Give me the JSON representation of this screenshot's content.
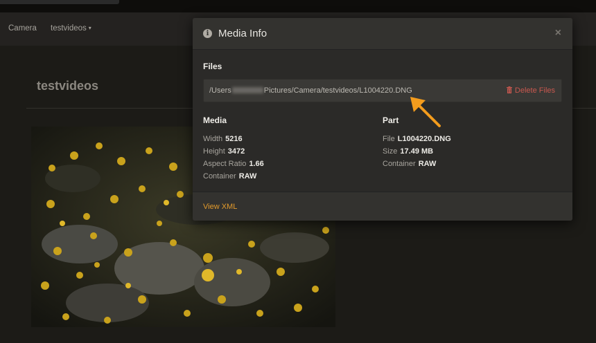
{
  "nav": {
    "camera_label": "Camera",
    "library_label": "testvideos",
    "caret": "▾"
  },
  "page": {
    "title": "testvideos"
  },
  "photo": {
    "description_icon": "autumn-leaves-photo"
  },
  "modal": {
    "info_glyph": "i",
    "title": "Media Info",
    "close_glyph": "×",
    "files_label": "Files",
    "path_prefix": "/Users",
    "path_suffix": "Pictures/Camera/testvideos/L1004220.DNG",
    "delete_label": "Delete Files",
    "media_label": "Media",
    "part_label": "Part",
    "media": [
      {
        "key": "Width",
        "value": "5216"
      },
      {
        "key": "Height",
        "value": "3472"
      },
      {
        "key": "Aspect Ratio",
        "value": "1.66"
      },
      {
        "key": "Container",
        "value": "RAW"
      }
    ],
    "part": [
      {
        "key": "File",
        "value": "L1004220.DNG"
      },
      {
        "key": "Size",
        "value": "17.49 MB"
      },
      {
        "key": "Container",
        "value": "RAW"
      }
    ],
    "view_xml_label": "View XML"
  },
  "colors": {
    "accent": "#e29a2c",
    "danger": "#c9584f",
    "arrow": "#f39c1d"
  }
}
